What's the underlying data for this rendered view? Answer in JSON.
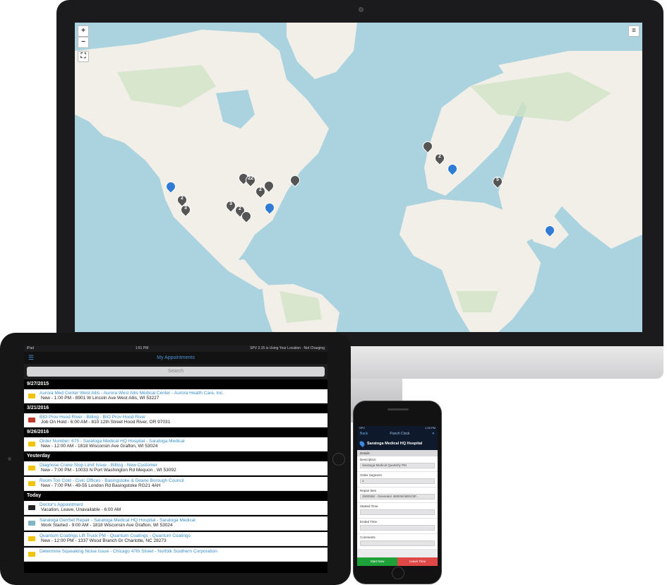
{
  "map": {
    "zoom_in": "+",
    "zoom_out": "−",
    "pins": [
      {
        "label": "",
        "color": "blue"
      },
      {
        "label": "2",
        "color": "gray"
      },
      {
        "label": "3",
        "color": "gray"
      },
      {
        "label": "",
        "color": "gray"
      },
      {
        "label": "22",
        "color": "gray"
      },
      {
        "label": "2",
        "color": "gray"
      },
      {
        "label": "",
        "color": "gray"
      },
      {
        "label": "3",
        "color": "gray"
      },
      {
        "label": "2",
        "color": "gray"
      },
      {
        "label": "",
        "color": "blue"
      },
      {
        "label": "",
        "color": "gray"
      },
      {
        "label": "",
        "color": "gray"
      },
      {
        "label": "",
        "color": "gray"
      },
      {
        "label": "2",
        "color": "gray"
      },
      {
        "label": "",
        "color": "blue"
      },
      {
        "label": "5",
        "color": "gray"
      },
      {
        "label": "",
        "color": "blue"
      }
    ]
  },
  "ipad": {
    "status_left": "iPad",
    "status_time": "1:51 PM",
    "status_right": "SPV 2.15 is Using Your Location · Not Charging",
    "nav_title": "My Appointments",
    "search_placeholder": "Search",
    "groups": [
      {
        "date": "9/27/2015",
        "items": [
          {
            "title": "Aurora Med Center West Allis - Aurora West Allis Medical Center - Aurora Health Care, Inc.",
            "detail": "New - 1:00 PM - 8901 W Lincoln Ave West Allis, WI 53227",
            "vehicle": "yellow"
          }
        ]
      },
      {
        "date": "3/21/2016",
        "items": [
          {
            "title": "BIO Prov Hood River  - Billing - BIO Prov Hood River",
            "detail": "Job On Hold - 6:00 AM - 810 12th Street Hood River, OR 97031",
            "vehicle": "red"
          }
        ]
      },
      {
        "date": "9/26/2016",
        "items": [
          {
            "title": "Order Number: 675 - Saratoga Medical HQ Hospital - Saratoga Medical",
            "detail": "New - 12:00 AM - 1818 Wisconsin Ave Grafton, WI 53024",
            "vehicle": "yellow"
          }
        ]
      },
      {
        "date": "Yesterday",
        "items": [
          {
            "title": "Diagnose Crane Stop Limit Issue - Billing - New Customer",
            "detail": "New - 7:00 PM - 10033 N Port Washington Rd Mequon , WI 53092",
            "vehicle": "yellow"
          },
          {
            "title": "Room Too Cold - Civic Offices - Basingstoke & Deane Borough Council",
            "detail": "New - 7:00 PM - 49-55 London Rd Basingstoke RG21 4AH",
            "vehicle": "yellow"
          }
        ]
      },
      {
        "date": "Today",
        "items": [
          {
            "title": "Doctor's Appointment",
            "detail": "Vacation, Leave, Unavailable - 6:00 AM",
            "vehicle": "black"
          },
          {
            "title": "Saratoga GenSet Repair - Saratoga Medical HQ Hospital - Saratoga Medical",
            "detail": "Work Started - 9:00 AM - 1818 Wisconsin Ave Grafton, WI 53024",
            "vehicle": "teal"
          },
          {
            "title": "Quantum Coatings Lift Truck PM - Quantum Coatings - Quantum Coatings",
            "detail": "New - 12:00 PM - 1337 Wood Branch Dr Charlotte, NC 28273",
            "vehicle": "yellow"
          },
          {
            "title": "Determine Squeaking Noise Issue - Chicago 47th Street - Norfolk Southern Corporation",
            "detail": "",
            "vehicle": "yellow"
          }
        ]
      }
    ]
  },
  "iphone": {
    "status_left": "SPV",
    "status_time": "1:26 PM",
    "back_label": "Back",
    "nav_title": "Punch Clock",
    "close_label": "✕",
    "site_name": "Saratoga Medical HQ Hospital",
    "section": "Details",
    "fields": [
      {
        "label": "Description",
        "value": "Saratoga Medical Quarterly PM"
      },
      {
        "label": "Order Segment",
        "value": "1"
      },
      {
        "label": "Repair Item",
        "value": "4500S60 - Generator 450KW/480V/3P..."
      },
      {
        "label": "Started Time",
        "value": ""
      },
      {
        "label": "Ended Time",
        "value": ""
      },
      {
        "label": "Comments",
        "value": ""
      }
    ],
    "start_button": "Start Now",
    "leave_button": "Leave Time"
  }
}
